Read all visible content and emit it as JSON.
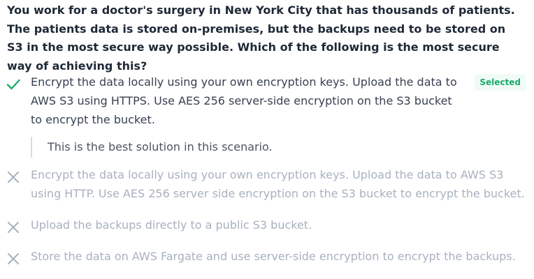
{
  "question": {
    "text": "You work for a doctor's surgery in New York City that has thousands of patients. The patients data is stored on-premises, but the backups need to be stored on S3 in the most secure way possible. Which of the following is the most secure way of achieving this?"
  },
  "options": [
    {
      "text": "Encrypt the data locally using your own encryption keys. Upload the data to AWS S3 using HTTPS. Use AES 256 server-side encryption on the S3 bucket to encrypt the bucket.",
      "icon": "check-icon",
      "badge": "Selected",
      "explanation": "This is the best solution in this scenario."
    },
    {
      "text": "Encrypt the data locally using your own encryption keys. Upload the data to AWS S3 using HTTP. Use AES 256 server side encryption on the S3 bucket to encrypt the bucket.",
      "icon": "x-icon"
    },
    {
      "text": "Upload the backups directly to a public S3 bucket.",
      "icon": "x-icon"
    },
    {
      "text": "Store the data on AWS Fargate and use server-side encryption to encrypt the backups.",
      "icon": "x-icon"
    }
  ],
  "colors": {
    "correct": "#1aab6b",
    "incorrect": "#a8b1bf",
    "badge_bg": "#f1fbf6"
  }
}
